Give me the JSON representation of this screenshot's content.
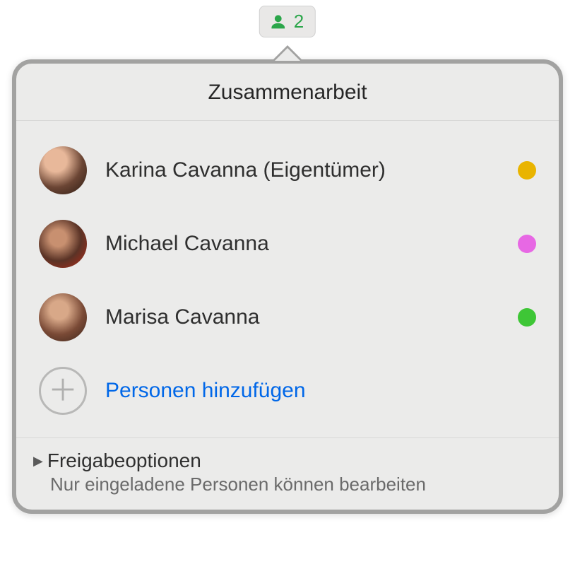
{
  "toolbar": {
    "collaborator_count": "2"
  },
  "popover": {
    "title": "Zusammenarbeit",
    "participants": [
      {
        "name": "Karina Cavanna (Eigentümer)",
        "presence_color": "#e9b400"
      },
      {
        "name": "Michael Cavanna",
        "presence_color": "#e768e4"
      },
      {
        "name": "Marisa Cavanna",
        "presence_color": "#3ec636"
      }
    ],
    "add_people_label": "Personen hinzufügen",
    "share_options": {
      "title": "Freigabeoptionen",
      "subtitle": "Nur eingeladene Personen können bearbeiten"
    }
  }
}
